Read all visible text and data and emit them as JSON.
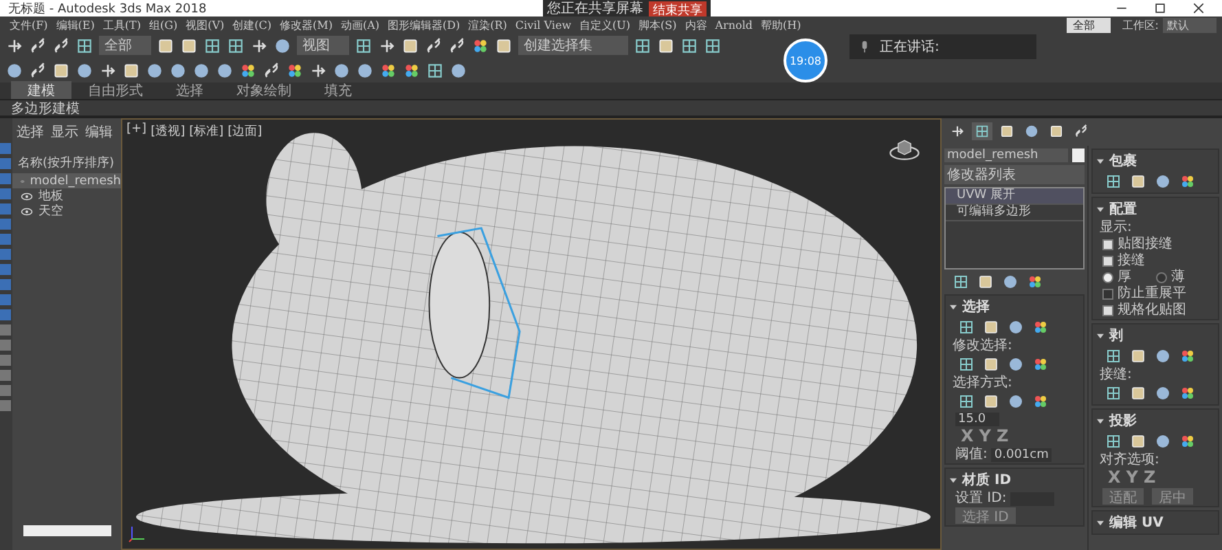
{
  "window": {
    "title": "无标题 - Autodesk 3ds Max 2018"
  },
  "share_bar": {
    "text": "您正在共享屏幕",
    "button": "结束共享"
  },
  "meeting": {
    "time": "19:08",
    "speaking": "正在讲话:"
  },
  "menu": [
    "文件(F)",
    "编辑(E)",
    "工具(T)",
    "组(G)",
    "视图(V)",
    "创建(C)",
    "修改器(M)",
    "动画(A)",
    "图形编辑器(D)",
    "渲染(R)",
    "Civil View",
    "自定义(U)",
    "脚本(S)",
    "内容",
    "Arnold",
    "帮助(H)"
  ],
  "user_dropdown": "全部",
  "workspace": {
    "label": "工作区:",
    "value": "默认"
  },
  "toolbar": {
    "filter": "全部",
    "coord": "视图",
    "selection_set": "创建选择集"
  },
  "ribbon": {
    "tabs": [
      {
        "label": "建模",
        "selected": true
      },
      {
        "label": "自由形式",
        "selected": false
      },
      {
        "label": "选择",
        "selected": false
      },
      {
        "label": "对象绘制",
        "selected": false
      },
      {
        "label": "填充",
        "selected": false
      }
    ],
    "panel": "多边形建模"
  },
  "scene_explorer": {
    "tabs": [
      "选择",
      "显示",
      "编辑"
    ],
    "header": "名称(按升序排序)",
    "items": [
      {
        "name": "model_remesh",
        "selected": true
      },
      {
        "name": "地板",
        "selected": false
      },
      {
        "name": "天空",
        "selected": false
      }
    ]
  },
  "viewport": {
    "labels": [
      "[+]",
      "[透视]",
      "[标准]",
      "[边面]"
    ]
  },
  "command_panel": {
    "tabs": [
      {
        "selected": false
      },
      {
        "selected": true
      },
      {
        "selected": false
      },
      {
        "selected": false
      },
      {
        "selected": false
      },
      {
        "selected": false
      }
    ],
    "left": [
      {
        "kind": "name",
        "value": "model_remesh"
      },
      {
        "kind": "dropdown",
        "value": "修改器列表"
      },
      {
        "kind": "stack",
        "items": [
          {
            "label": "UVW 展开",
            "selected": true
          },
          {
            "label": "可编辑多边形",
            "selected": false
          }
        ]
      },
      {
        "kind": "icons"
      },
      {
        "kind": "rollout",
        "title": "选择",
        "rows": [
          {
            "kind": "icons"
          },
          {
            "kind": "label",
            "text": "修改选择:"
          },
          {
            "kind": "icons"
          },
          {
            "kind": "label",
            "text": "选择方式:"
          },
          {
            "kind": "icons"
          },
          {
            "kind": "field",
            "label": "",
            "value": "15.0"
          },
          {
            "kind": "letters",
            "letters": [
              "X",
              "Y",
              "Z"
            ]
          },
          {
            "kind": "field",
            "label": "阈值:",
            "value": "0.001cm"
          }
        ]
      },
      {
        "kind": "rollout",
        "title": "材质 ID",
        "rows": [
          {
            "kind": "field",
            "label": "设置 ID:",
            "value": ""
          },
          {
            "kind": "buttons",
            "labels": [
              "选择 ID"
            ]
          }
        ]
      }
    ],
    "right": [
      {
        "kind": "rollout",
        "title": "包裹",
        "rows": [
          {
            "kind": "icons"
          }
        ]
      },
      {
        "kind": "rollout",
        "title": "配置",
        "rows": [
          {
            "kind": "label",
            "text": "显示:"
          },
          {
            "kind": "check",
            "label": "贴图接缝",
            "checked": true
          },
          {
            "kind": "check",
            "label": "接缝",
            "checked": true
          },
          {
            "kind": "radios",
            "options": [
              {
                "label": "厚",
                "selected": true
              },
              {
                "label": "薄",
                "selected": false
              }
            ]
          },
          {
            "kind": "check",
            "label": "防止重展平",
            "checked": false
          },
          {
            "kind": "check",
            "label": "规格化贴图",
            "checked": true
          }
        ]
      },
      {
        "kind": "rollout",
        "title": "剥",
        "rows": [
          {
            "kind": "icons"
          },
          {
            "kind": "label",
            "text": "接缝:"
          },
          {
            "kind": "icons"
          }
        ]
      },
      {
        "kind": "rollout",
        "title": "投影",
        "rows": [
          {
            "kind": "icons"
          },
          {
            "kind": "label",
            "text": "对齐选项:"
          },
          {
            "kind": "letters",
            "letters": [
              "X",
              "Y",
              "Z"
            ]
          },
          {
            "kind": "buttons",
            "labels": [
              "适配",
              "居中"
            ]
          }
        ]
      },
      {
        "kind": "rollout",
        "title": "编辑 UV"
      }
    ]
  }
}
